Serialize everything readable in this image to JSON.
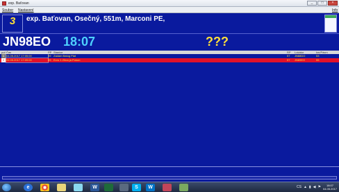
{
  "window": {
    "title": "exp. Baťovan",
    "minimize": "_",
    "maximize": "□",
    "close": "×"
  },
  "menu": {
    "items": [
      "Soubor",
      "Nastavení"
    ],
    "right_item": "Info"
  },
  "info": {
    "number": "3",
    "header": "exp. Baťovan, Osečný, 551m, Marconi PE,"
  },
  "readout": {
    "locator": "JN98EO",
    "time": "18:07",
    "unknown": "???"
  },
  "table": {
    "columns": {
      "por": "poř.",
      "cas": "Čas",
      "pp": "PP",
      "stanice": "Stanice",
      "rp": "RP",
      "lokator": "Lokátor",
      "bod": "km/Pásm"
    },
    "rows": [
      {
        "por": "1",
        "cas": "04.05.2017 17:05:00",
        "pp": "59",
        "stanice": "Zadam Batog Plat",
        "rp": "57",
        "lokator": "JN88DO",
        "bod": "53"
      },
      {
        "por": "2",
        "cas": "04.05.2017 17:09:00",
        "pp": "59",
        "stanice": "Evro 1 Zlína ja Potom",
        "rp": "57",
        "lokator": "JN89EO",
        "bod": "55"
      }
    ]
  },
  "taskbar": {
    "apps": [
      "start",
      "ie",
      "chrome",
      "explorer",
      "winamp",
      "word",
      "excel",
      "app",
      "skype",
      "outlook",
      "app2",
      "app3"
    ],
    "tray_lang": "CS",
    "time": "18:07",
    "date": "04.05.2017"
  },
  "colors": {
    "background": "#0a1a9e",
    "accent_yellow": "#ffe03a",
    "accent_cyan": "#4ed1ff",
    "row_highlight": "#e2112a"
  }
}
